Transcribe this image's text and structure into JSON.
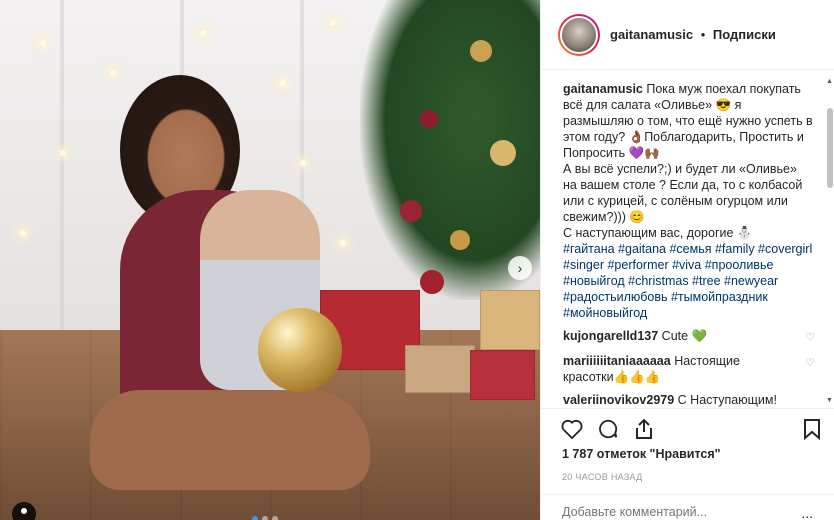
{
  "header": {
    "username": "gaitanamusic",
    "separator": "•",
    "follow_label": "Подписки"
  },
  "caption": {
    "username": "gaitanamusic",
    "text": "Пока муж поехал покупать всё для салата «Оливье» 😎 я размышляю о том, что ещё нужно успеть в этом году? 👌🏾Поблагодарить, Простить и Попросить 💜🙌🏾",
    "text2": "А вы всё успели?;) и будет ли «Оливье» на вашем столе ? Если да, то с колбасой или с курицей, с солёным огурцом или свежим?))) 😊",
    "text3": "С наступающим вас, дорогие ⛄",
    "hashtags": "#гайтана #gaitana #семья #family #covergirl #singer #performer #viva #прооливье #новыйгод #christmas #tree #newyear #радостьилюбовь #тымойпраздник #мойновыйгод"
  },
  "comments": [
    {
      "username": "kujongarelld137",
      "text": "Cute 💚"
    },
    {
      "username": "mariiiiiitaniaaaaaa",
      "text": "Настоящие красотки👍👍👍"
    },
    {
      "username": "valeriinovikov2979",
      "text": "С Наступающим! Пусть праздник весело встретит"
    }
  ],
  "likes_text": "1 787 отметок \"Нравится\"",
  "time_text": "20 ЧАСОВ НАЗАД",
  "add_comment_placeholder": "Добавьте комментарий...",
  "more_label": "..."
}
